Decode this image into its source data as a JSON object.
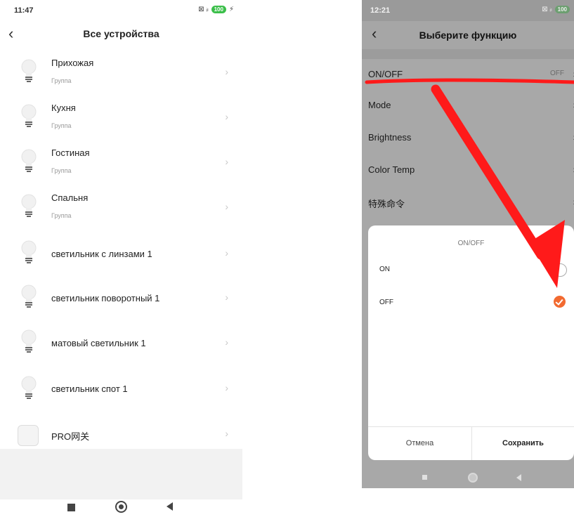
{
  "left": {
    "status": {
      "time": "11:47",
      "signal": "⊠ ᵢₗ",
      "battery": "100",
      "charge": "⚡"
    },
    "header": {
      "back": "‹",
      "title": "Все устройства"
    },
    "devices": [
      {
        "name": "Прихожая",
        "type": "Группа",
        "icon": "lightbulb-icon"
      },
      {
        "name": "Кухня",
        "type": "Группа",
        "icon": "lightbulb-icon"
      },
      {
        "name": "Гостиная",
        "type": "Группа",
        "icon": "lightbulb-icon"
      },
      {
        "name": "Спальня",
        "type": "Группа",
        "icon": "lightbulb-icon"
      },
      {
        "name": "светильник с линзами 1",
        "type": "",
        "icon": "lightbulb-icon"
      },
      {
        "name": "светильник поворотный 1",
        "type": "",
        "icon": "lightbulb-icon"
      },
      {
        "name": "матовый светильник 1",
        "type": "",
        "icon": "lightbulb-icon"
      },
      {
        "name": "светильник спот 1",
        "type": "",
        "icon": "lightbulb-icon"
      },
      {
        "name": "PRO网关",
        "type": "",
        "icon": "gateway-icon"
      }
    ],
    "chevron": "›"
  },
  "right": {
    "status": {
      "time": "12:21",
      "signal": "⊠ ᵢₗ",
      "battery": "100"
    },
    "header": {
      "back": "‹",
      "title": "Выберите функцию"
    },
    "functions": [
      {
        "label": "ON/OFF",
        "value": "OFF"
      },
      {
        "label": "Mode",
        "value": ""
      },
      {
        "label": "Brightness",
        "value": ""
      },
      {
        "label": "Color Temp",
        "value": ""
      },
      {
        "label": "特殊命令",
        "value": ""
      }
    ],
    "chevron": "›",
    "dialog": {
      "title": "ON/OFF",
      "options": [
        {
          "label": "ON",
          "selected": false
        },
        {
          "label": "OFF",
          "selected": true
        }
      ],
      "cancel": "Отмена",
      "save": "Сохранить"
    }
  },
  "colors": {
    "accent": "#f26a30",
    "annotation": "#ff1a1a",
    "battery_green": "#3bbf4a",
    "overlay_gray": "#a8a8a8"
  }
}
